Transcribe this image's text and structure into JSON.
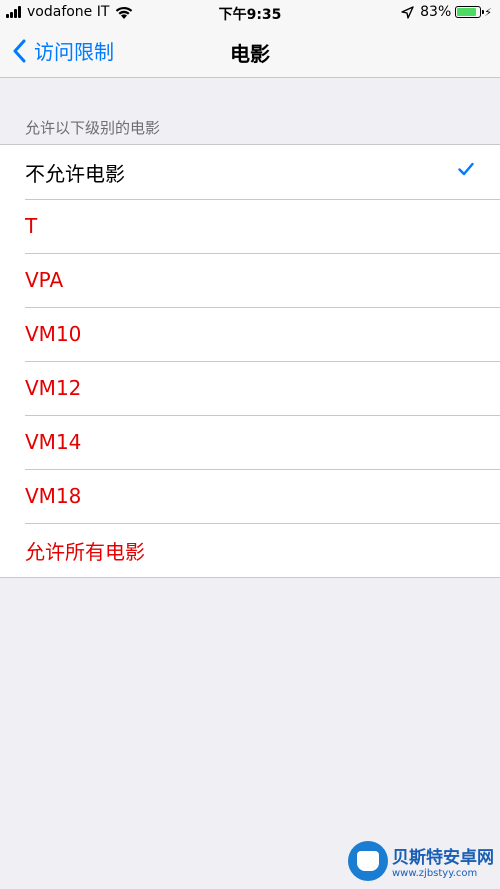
{
  "status_bar": {
    "carrier": "vodafone IT",
    "time": "下午9:35",
    "battery_percent": "83%",
    "battery_level": 0.83,
    "icons": [
      "signal-icon",
      "wifi-icon",
      "location-arrow-icon",
      "battery-icon",
      "charging-bolt-icon"
    ]
  },
  "nav": {
    "back_label": "访问限制",
    "title": "电影"
  },
  "section": {
    "header": "允许以下级别的电影"
  },
  "ratings": [
    {
      "label": "不允许电影",
      "selected": true,
      "restricted": false
    },
    {
      "label": "T",
      "selected": false,
      "restricted": true
    },
    {
      "label": "VPA",
      "selected": false,
      "restricted": true
    },
    {
      "label": "VM10",
      "selected": false,
      "restricted": true
    },
    {
      "label": "VM12",
      "selected": false,
      "restricted": true
    },
    {
      "label": "VM14",
      "selected": false,
      "restricted": true
    },
    {
      "label": "VM18",
      "selected": false,
      "restricted": true
    },
    {
      "label": "允许所有电影",
      "selected": false,
      "restricted": true
    }
  ],
  "colors": {
    "accent": "#007aff",
    "restricted_text": "#e40000",
    "background": "#efeff4"
  },
  "watermark": {
    "title": "贝斯特安卓网",
    "url": "www.zjbstyy.com"
  }
}
